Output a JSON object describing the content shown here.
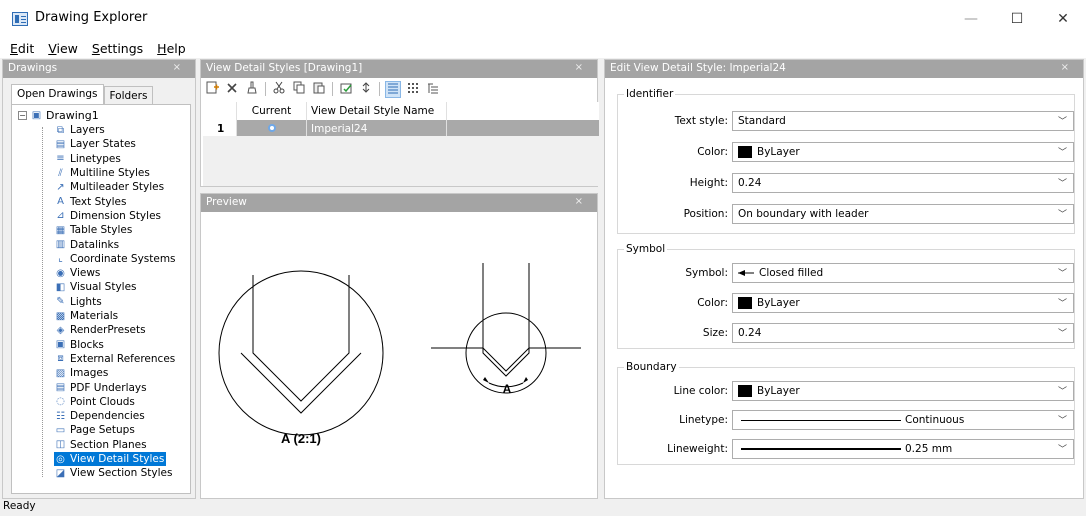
{
  "window": {
    "title": "Drawing Explorer",
    "minimize_glyph": "—",
    "maximize_glyph": "☐",
    "close_glyph": "✕"
  },
  "menu": [
    "Edit",
    "View",
    "Settings",
    "Help"
  ],
  "drawings_panel": {
    "title": "Drawings",
    "close": "×",
    "tabs": [
      "Open Drawings",
      "Folders"
    ],
    "root": "Drawing1",
    "items": [
      {
        "label": "Layers",
        "icon": "layers-icon"
      },
      {
        "label": "Layer States",
        "icon": "layer-states-icon"
      },
      {
        "label": "Linetypes",
        "icon": "linetypes-icon"
      },
      {
        "label": "Multiline Styles",
        "icon": "multiline-icon"
      },
      {
        "label": "Multileader Styles",
        "icon": "multileader-icon"
      },
      {
        "label": "Text Styles",
        "icon": "text-style-icon"
      },
      {
        "label": "Dimension Styles",
        "icon": "dimension-icon"
      },
      {
        "label": "Table Styles",
        "icon": "table-icon"
      },
      {
        "label": "Datalinks",
        "icon": "datalink-icon"
      },
      {
        "label": "Coordinate Systems",
        "icon": "coordinate-icon"
      },
      {
        "label": "Views",
        "icon": "eye-icon"
      },
      {
        "label": "Visual Styles",
        "icon": "visual-styles-icon"
      },
      {
        "label": "Lights",
        "icon": "light-icon"
      },
      {
        "label": "Materials",
        "icon": "materials-icon"
      },
      {
        "label": "RenderPresets",
        "icon": "render-icon"
      },
      {
        "label": "Blocks",
        "icon": "blocks-icon"
      },
      {
        "label": "External References",
        "icon": "xref-icon"
      },
      {
        "label": "Images",
        "icon": "image-icon"
      },
      {
        "label": "PDF Underlays",
        "icon": "pdf-icon"
      },
      {
        "label": "Point Clouds",
        "icon": "point-cloud-icon"
      },
      {
        "label": "Dependencies",
        "icon": "dependencies-icon"
      },
      {
        "label": "Page Setups",
        "icon": "page-setup-icon"
      },
      {
        "label": "Section Planes",
        "icon": "section-plane-icon"
      },
      {
        "label": "View Detail Styles",
        "icon": "view-detail-icon",
        "selected": true
      },
      {
        "label": "View Section Styles",
        "icon": "view-section-icon"
      }
    ]
  },
  "styles_panel": {
    "title": "View Detail Styles [Drawing1]",
    "close": "×",
    "columns": [
      "",
      "Current",
      "View Detail Style Name",
      ""
    ],
    "rows": [
      {
        "index": "1",
        "name": "Imperial24"
      }
    ]
  },
  "preview_panel": {
    "title": "Preview",
    "close": "×",
    "detail_caption": "A (2:1)",
    "marker_label": "A"
  },
  "edit_panel": {
    "title": "Edit View Detail Style: Imperial24",
    "close": "×",
    "groups": {
      "identifier": "Identifier",
      "symbol": "Symbol",
      "boundary": "Boundary"
    },
    "identifier": {
      "text_style_label": "Text style:",
      "text_style": "Standard",
      "color_label": "Color:",
      "color": "ByLayer",
      "height_label": "Height:",
      "height": "0.24",
      "position_label": "Position:",
      "position": "On boundary with leader"
    },
    "symbol": {
      "symbol_label": "Symbol:",
      "symbol": "Closed filled",
      "color_label": "Color:",
      "color": "ByLayer",
      "size_label": "Size:",
      "size": "0.24"
    },
    "boundary": {
      "line_color_label": "Line color:",
      "line_color": "ByLayer",
      "linetype_label": "Linetype:",
      "linetype": "Continuous",
      "lineweight_label": "Lineweight:",
      "lineweight": "0.25 mm"
    }
  },
  "status": "Ready"
}
